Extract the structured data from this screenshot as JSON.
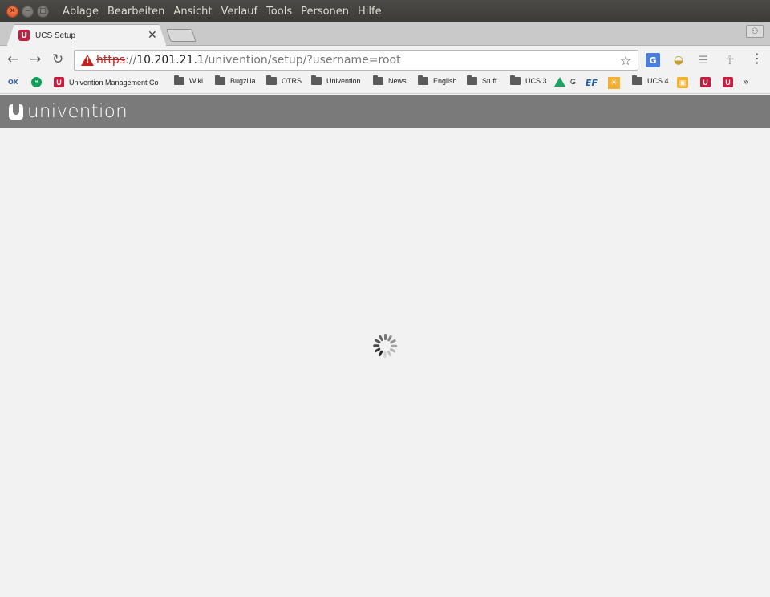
{
  "window": {
    "menu": [
      "Ablage",
      "Bearbeiten",
      "Ansicht",
      "Verlauf",
      "Tools",
      "Personen",
      "Hilfe"
    ]
  },
  "tab": {
    "title": "UCS Setup",
    "favicon": "u-icon"
  },
  "address_bar": {
    "scheme": "https",
    "separator": "://",
    "host": "10.201.21.1",
    "path": "/univention/setup/?username=root",
    "security": "not-secure-warning-icon"
  },
  "bookmarks": [
    {
      "icon": "ox-icon",
      "label": ""
    },
    {
      "icon": "hangouts-icon",
      "label": ""
    },
    {
      "icon": "u-icon",
      "label": "Univention Management Co"
    },
    {
      "icon": "folder-icon",
      "label": "Wiki"
    },
    {
      "icon": "folder-icon",
      "label": "Bugzilla"
    },
    {
      "icon": "folder-icon",
      "label": "OTRS"
    },
    {
      "icon": "folder-icon",
      "label": "Univention"
    },
    {
      "icon": "folder-icon",
      "label": "News"
    },
    {
      "icon": "folder-icon",
      "label": "English"
    },
    {
      "icon": "folder-icon",
      "label": "Stuff"
    },
    {
      "icon": "folder-icon",
      "label": "UCS 3"
    },
    {
      "icon": "drive-icon",
      "label": "G"
    },
    {
      "icon": "ef-icon",
      "label": ""
    },
    {
      "icon": "sun-icon",
      "label": ""
    },
    {
      "icon": "folder-icon",
      "label": "UCS 4"
    },
    {
      "icon": "box-icon",
      "label": ""
    },
    {
      "icon": "u-icon",
      "label": ""
    },
    {
      "icon": "u-icon",
      "label": ""
    }
  ],
  "bookmarks_more": "»",
  "header": {
    "logo_text": "univention"
  },
  "colors": {
    "header_bg": "#7a7a7a",
    "page_bg": "#f2f2f2",
    "brand_red": "#c51d3e",
    "warning_red": "#c5221f"
  }
}
